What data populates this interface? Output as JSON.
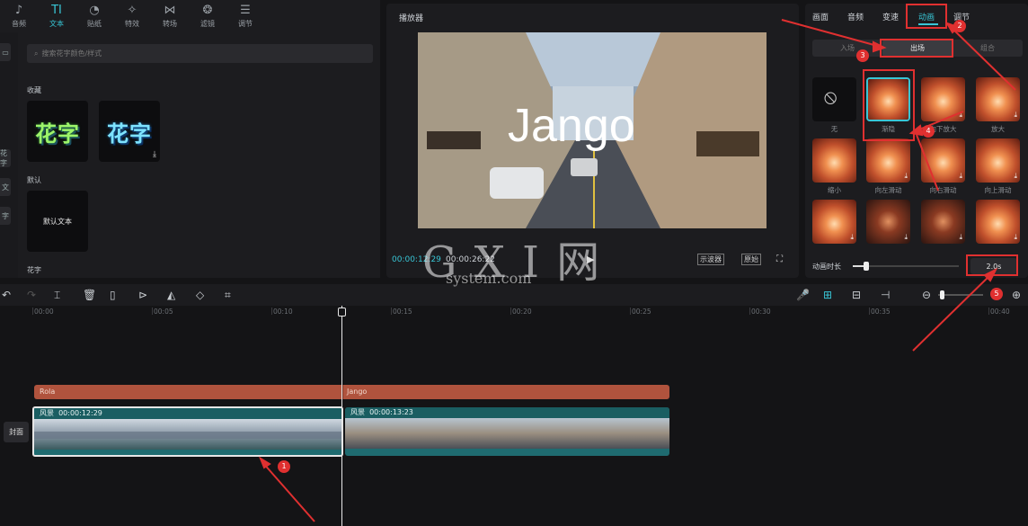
{
  "top_tabs": [
    {
      "icon": "music-icon",
      "glyph": "♪",
      "label": "音频"
    },
    {
      "icon": "text-icon",
      "glyph": "TI",
      "label": "文本",
      "active": true
    },
    {
      "icon": "sticker-icon",
      "glyph": "◔",
      "label": "贴纸"
    },
    {
      "icon": "effects-icon",
      "glyph": "✧",
      "label": "特效"
    },
    {
      "icon": "transition-icon",
      "glyph": "⋈",
      "label": "转场"
    },
    {
      "icon": "filter-icon",
      "glyph": "❂",
      "label": "滤镜"
    },
    {
      "icon": "adjust-icon",
      "glyph": "☰",
      "label": "调节"
    }
  ],
  "library": {
    "search_placeholder": "搜索花字颜色/样式",
    "section_favorites": "收藏",
    "section_default": "默认",
    "default_text": "默认文本",
    "section_huazi": "花字",
    "huazi_text": "花字",
    "left_tags": [
      "花字",
      "文",
      "字"
    ]
  },
  "player": {
    "title": "播放器",
    "overlay_text": "Jango",
    "current_time": "00:00:12:29",
    "total_time": "00:00:26:22",
    "btn_scope": "示波器",
    "btn_original": "原始"
  },
  "right_panel": {
    "tabs": [
      "画面",
      "音频",
      "变速",
      "动画",
      "调节"
    ],
    "active_tab": "动画",
    "subtabs": [
      "入场",
      "出场",
      "组合"
    ],
    "active_subtab": "出场",
    "effects": [
      {
        "label": "无",
        "style": "none"
      },
      {
        "label": "渐隐",
        "style": "fade",
        "selected": true
      },
      {
        "label": "向下放大",
        "style": "zoom",
        "dl": true
      },
      {
        "label": "放大",
        "style": "zoom",
        "dl": true
      },
      {
        "label": "缩小",
        "style": "zoom"
      },
      {
        "label": "向左滑动",
        "style": "zoom",
        "dl": true
      },
      {
        "label": "向右滑动",
        "style": "zoom",
        "dl": true
      },
      {
        "label": "向上滑动",
        "style": "zoom",
        "dl": true
      },
      {
        "label": "",
        "style": "zoom",
        "dl": true
      },
      {
        "label": "",
        "style": "dark",
        "dl": true
      },
      {
        "label": "",
        "style": "dark",
        "dl": true
      },
      {
        "label": "",
        "style": "zoom",
        "dl": true
      }
    ],
    "duration_label": "动画时长",
    "duration_value": "2.0s"
  },
  "timeline": {
    "ruler": [
      "00:00",
      "00:05",
      "00:10",
      "00:15",
      "00:20",
      "00:25",
      "00:30",
      "00:35",
      "00:40"
    ],
    "text_clips": [
      "Rola",
      "Jango"
    ],
    "clip1": {
      "name": "风景",
      "time": "00:00:12:29"
    },
    "clip2": {
      "name": "风景",
      "time": "00:00:13:23"
    },
    "cover_label": "封面"
  },
  "badges": [
    "1",
    "2",
    "3",
    "4",
    "5"
  ],
  "watermark": {
    "main": "G X I 网",
    "sub": "system.com"
  },
  "colors": {
    "accent": "#38c6d6",
    "annotation": "#e03030",
    "text_clip": "#b0533d",
    "video_clip": "#1f6b70"
  }
}
